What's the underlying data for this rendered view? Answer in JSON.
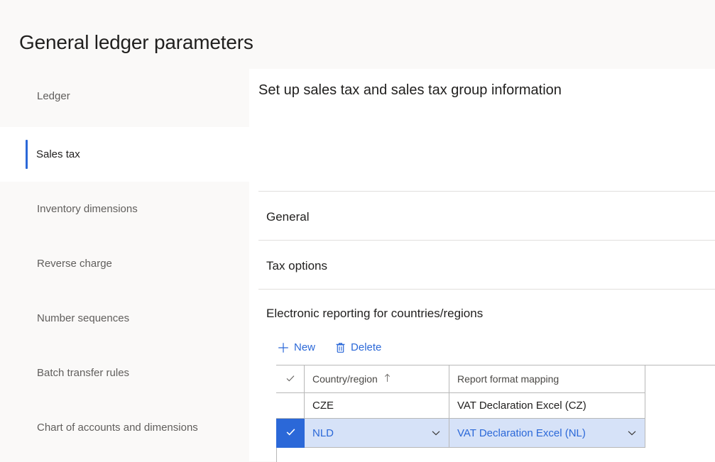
{
  "page": {
    "title": "General ledger parameters",
    "accent_color": "#2b68d8",
    "selected_row_background": "#d6e2f8",
    "page_background": "#faf9f8"
  },
  "sidebar": {
    "items": [
      {
        "label": "Ledger",
        "selected": false
      },
      {
        "label": "Sales tax",
        "selected": true
      },
      {
        "label": "Inventory dimensions",
        "selected": false
      },
      {
        "label": "Reverse charge",
        "selected": false
      },
      {
        "label": "Number sequences",
        "selected": false
      },
      {
        "label": "Batch transfer rules",
        "selected": false
      },
      {
        "label": "Chart of accounts and dimensions",
        "selected": false
      }
    ]
  },
  "content": {
    "title": "Set up sales tax and sales tax group information",
    "sections": [
      {
        "label": "General",
        "expanded": false
      },
      {
        "label": "Tax options",
        "expanded": false
      },
      {
        "label": "Electronic reporting for countries/regions",
        "expanded": true
      }
    ]
  },
  "toolbar": {
    "new_label": "New",
    "new_icon": "plus-icon",
    "delete_label": "Delete",
    "delete_icon": "trash-icon"
  },
  "grid": {
    "select_all_icon": "checkmark-icon",
    "columns": [
      {
        "header": "Country/region",
        "sorted": true,
        "sort_icon": "arrow-up-icon"
      },
      {
        "header": "Report format mapping",
        "sorted": false,
        "sort_icon": ""
      }
    ],
    "rows": [
      {
        "selected": false,
        "country_region": "CZE",
        "report_format_mapping": "VAT Declaration Excel (CZ)"
      },
      {
        "selected": true,
        "country_region": "NLD",
        "report_format_mapping": "VAT Declaration Excel (NL)",
        "lookup_icon": "chevron-down-icon"
      }
    ]
  }
}
